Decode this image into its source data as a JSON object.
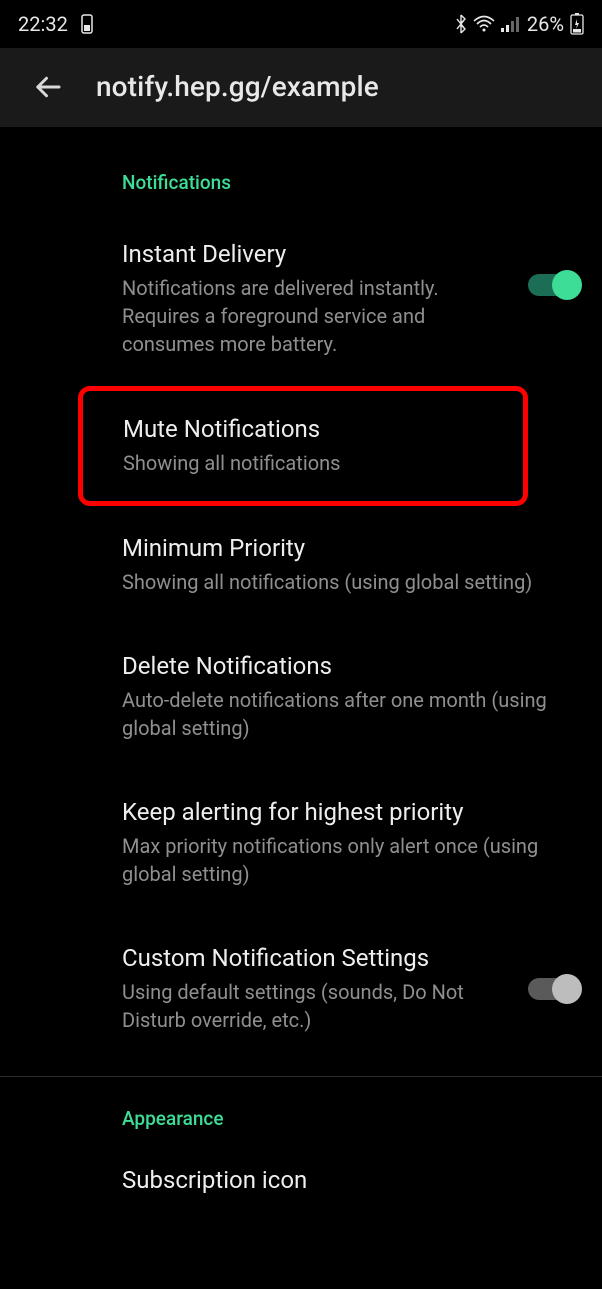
{
  "status_bar": {
    "time": "22:32",
    "battery_pct": "26%"
  },
  "header": {
    "title": "notify.hep.gg/example"
  },
  "sections": {
    "notifications": {
      "header": "Notifications",
      "items": {
        "instant_delivery": {
          "title": "Instant Delivery",
          "subtitle": "Notifications are delivered instantly. Requires a foreground service and consumes more battery.",
          "toggle": true
        },
        "mute": {
          "title": "Mute Notifications",
          "subtitle": "Showing all notifications"
        },
        "min_priority": {
          "title": "Minimum Priority",
          "subtitle": "Showing all notifications (using global setting)"
        },
        "delete": {
          "title": "Delete Notifications",
          "subtitle": "Auto-delete notifications after one month (using global setting)"
        },
        "keep_alerting": {
          "title": "Keep alerting for highest priority",
          "subtitle": "Max priority notifications only alert once (using global setting)"
        },
        "custom": {
          "title": "Custom Notification Settings",
          "subtitle": "Using default settings (sounds, Do Not Disturb override, etc.)",
          "toggle": false
        }
      }
    },
    "appearance": {
      "header": "Appearance",
      "items": {
        "sub_icon": {
          "title": "Subscription icon"
        }
      }
    }
  }
}
